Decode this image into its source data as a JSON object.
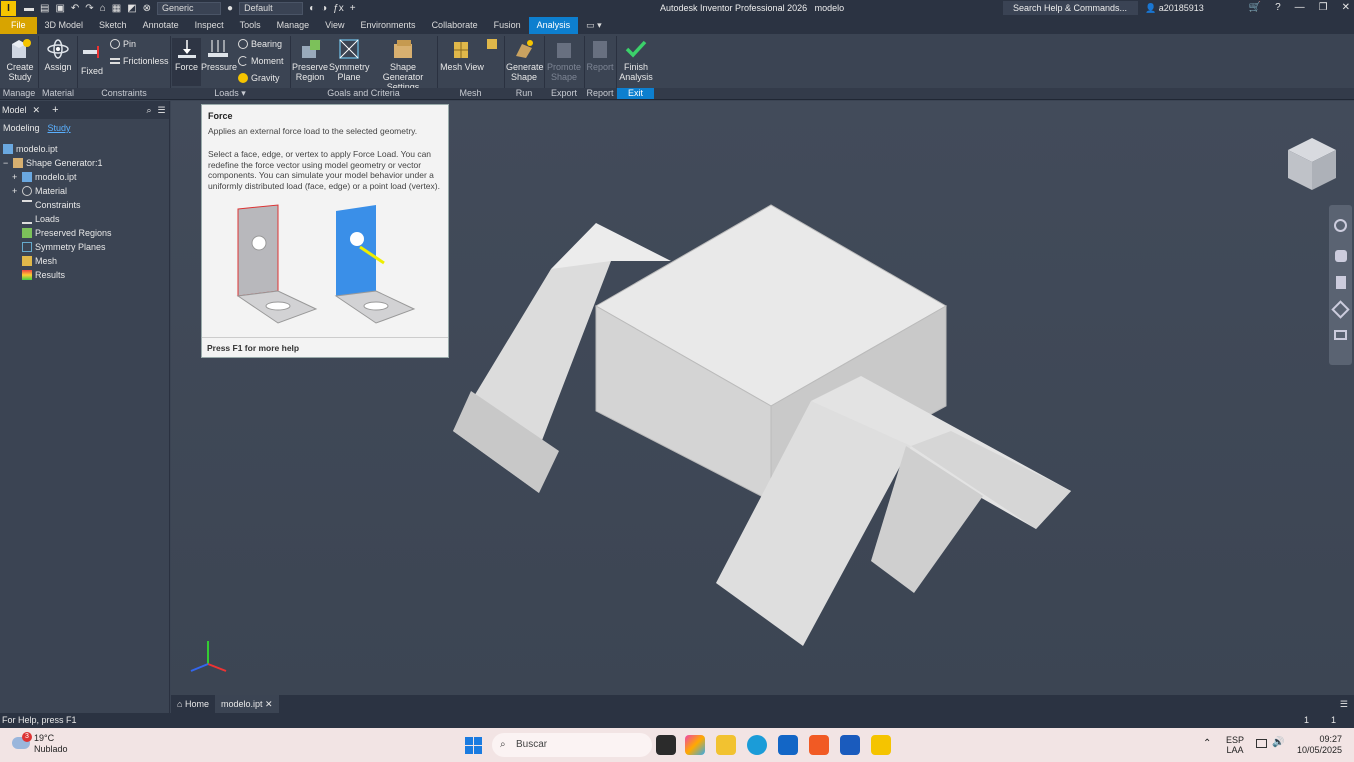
{
  "titlebar": {
    "logo": "I",
    "appearance": "Generic",
    "material": "Default",
    "title": "Autodesk Inventor Professional 2026",
    "document": "modelo",
    "search_placeholder": "Search Help & Commands...",
    "user": "a20185913"
  },
  "tabs": [
    "File",
    "3D Model",
    "Sketch",
    "Annotate",
    "Inspect",
    "Tools",
    "Manage",
    "View",
    "Environments",
    "Collaborate",
    "Fusion",
    "Analysis"
  ],
  "ribbon": {
    "create_study": "Create\nStudy",
    "assign": "Assign",
    "fixed": "Fixed",
    "pin": "Pin",
    "frictionless": "Frictionless",
    "force": "Force",
    "pressure": "Pressure",
    "bearing": "Bearing",
    "moment": "Moment",
    "gravity": "Gravity",
    "preserve_region": "Preserve\nRegion",
    "symmetry_plane": "Symmetry\nPlane",
    "shape_generator_settings": "Shape Generator\nSettings",
    "mesh_view": "Mesh View",
    "generate_shape": "Generate\nShape",
    "promote_shape": "Promote\nShape",
    "report": "Report",
    "finish_analysis": "Finish\nAnalysis",
    "groups": {
      "manage": "Manage",
      "material": "Material",
      "constraints": "Constraints",
      "loads": "Loads",
      "goals": "Goals and Criteria",
      "mesh": "Mesh",
      "run": "Run",
      "export": "Export",
      "report": "Report",
      "exit": "Exit"
    }
  },
  "browser": {
    "tab": "Model",
    "sub_modeling": "Modeling",
    "sub_study": "Study",
    "items": [
      {
        "label": "modelo.ipt"
      },
      {
        "label": "Shape Generator:1"
      },
      {
        "label": "modelo.ipt"
      },
      {
        "label": "Material"
      },
      {
        "label": "Constraints"
      },
      {
        "label": "Loads"
      },
      {
        "label": "Preserved Regions"
      },
      {
        "label": "Symmetry Planes"
      },
      {
        "label": "Mesh"
      },
      {
        "label": "Results"
      }
    ]
  },
  "tooltip": {
    "title": "Force",
    "description": "Applies an external force load to the selected geometry.",
    "body": "Select a face, edge, or vertex to apply Force Load. You can redefine the force vector using model geometry or vector components. You can simulate your model behavior under a uniformly distributed load (face, edge) or a point load (vertex).",
    "footer": "Press F1 for more help"
  },
  "doc_tabs": {
    "home": "Home",
    "file": "modelo.ipt"
  },
  "status": {
    "help": "For Help, press F1",
    "count1": "1",
    "count2": "1"
  },
  "taskbar": {
    "weather_temp": "19°C",
    "weather_desc": "Nublado",
    "weather_badge": "3",
    "search": "Buscar",
    "lang": "ESP",
    "lang2": "LAA",
    "time": "09:27",
    "date": "10/05/2025"
  },
  "colors": {
    "accent": "#0d7fcf",
    "file_tab": "#d8a400",
    "viewport": "#424b5a"
  }
}
